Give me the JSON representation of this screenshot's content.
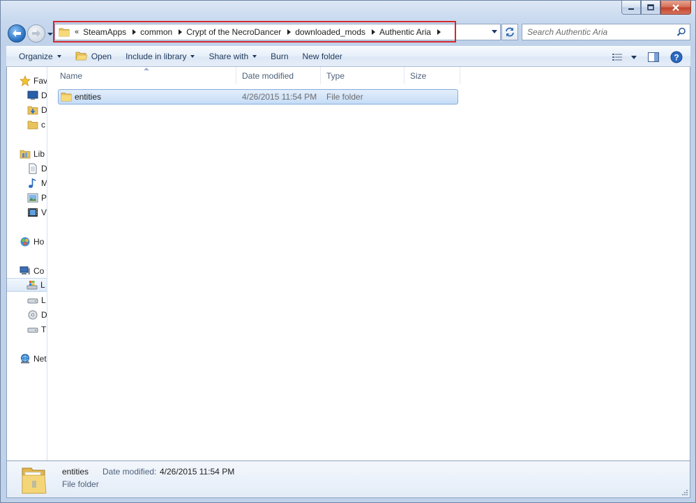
{
  "address_bar": {
    "overflow": "«",
    "crumbs": [
      "SteamApps",
      "common",
      "Crypt of the NecroDancer",
      "downloaded_mods",
      "Authentic Aria"
    ]
  },
  "search": {
    "placeholder": "Search Authentic Aria"
  },
  "toolbar": {
    "organize": "Organize",
    "open": "Open",
    "include_in_library": "Include in library",
    "share_with": "Share with",
    "burn": "Burn",
    "new_folder": "New folder"
  },
  "nav_pane": {
    "favorites": "Fav",
    "fav_items": [
      "D",
      "D",
      "c"
    ],
    "libraries": "Lib",
    "lib_items": [
      "D",
      "M",
      "P",
      "V"
    ],
    "homegroup": "Ho",
    "computer": "Co",
    "computer_items": [
      "L",
      "L",
      "D",
      "T"
    ],
    "network": "Net"
  },
  "columns": {
    "name": "Name",
    "date_modified": "Date modified",
    "type": "Type",
    "size": "Size"
  },
  "files": [
    {
      "name": "entities",
      "date_modified": "4/26/2015 11:54 PM",
      "type": "File folder",
      "size": ""
    }
  ],
  "details": {
    "name": "entities",
    "date_label": "Date modified:",
    "date_value": "4/26/2015 11:54 PM",
    "type": "File folder"
  },
  "colors": {
    "accent": "#2f78c8",
    "highlight_border": "#d4272c",
    "selection": "#c5dcf6"
  }
}
